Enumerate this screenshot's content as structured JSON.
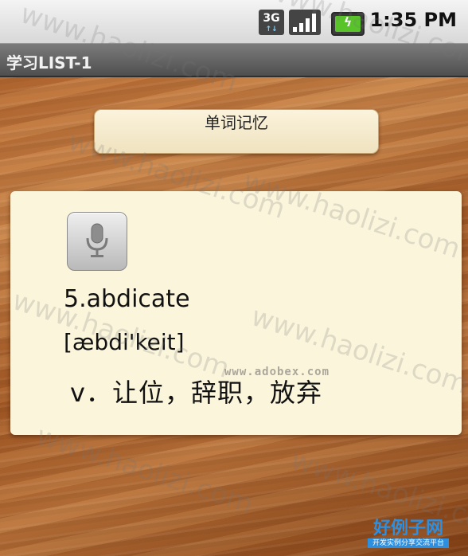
{
  "status_bar": {
    "network_label": "3G",
    "time": "1:35 PM",
    "icons": [
      "3g-icon",
      "signal-icon",
      "battery-charging-icon"
    ]
  },
  "title_bar": {
    "title": "学习LIST-1"
  },
  "memory_button": {
    "label": "单词记忆"
  },
  "card": {
    "word": "5.abdicate",
    "phonetic": "[æbdi'keit]",
    "meaning": "v．让位，辞职，放弃",
    "mic_icon": "microphone-icon"
  },
  "watermarks": {
    "site": "www.haolizi.com",
    "adobe": "www.adobex.com",
    "logo_text": "好例子网",
    "logo_sub": "开发实例分享交流平台"
  },
  "colors": {
    "card_bg": "#fbf5dc",
    "title_bar_bg": "#5f5f5f",
    "battery_green": "#58c42a",
    "logo_blue": "#2d8fe0"
  }
}
